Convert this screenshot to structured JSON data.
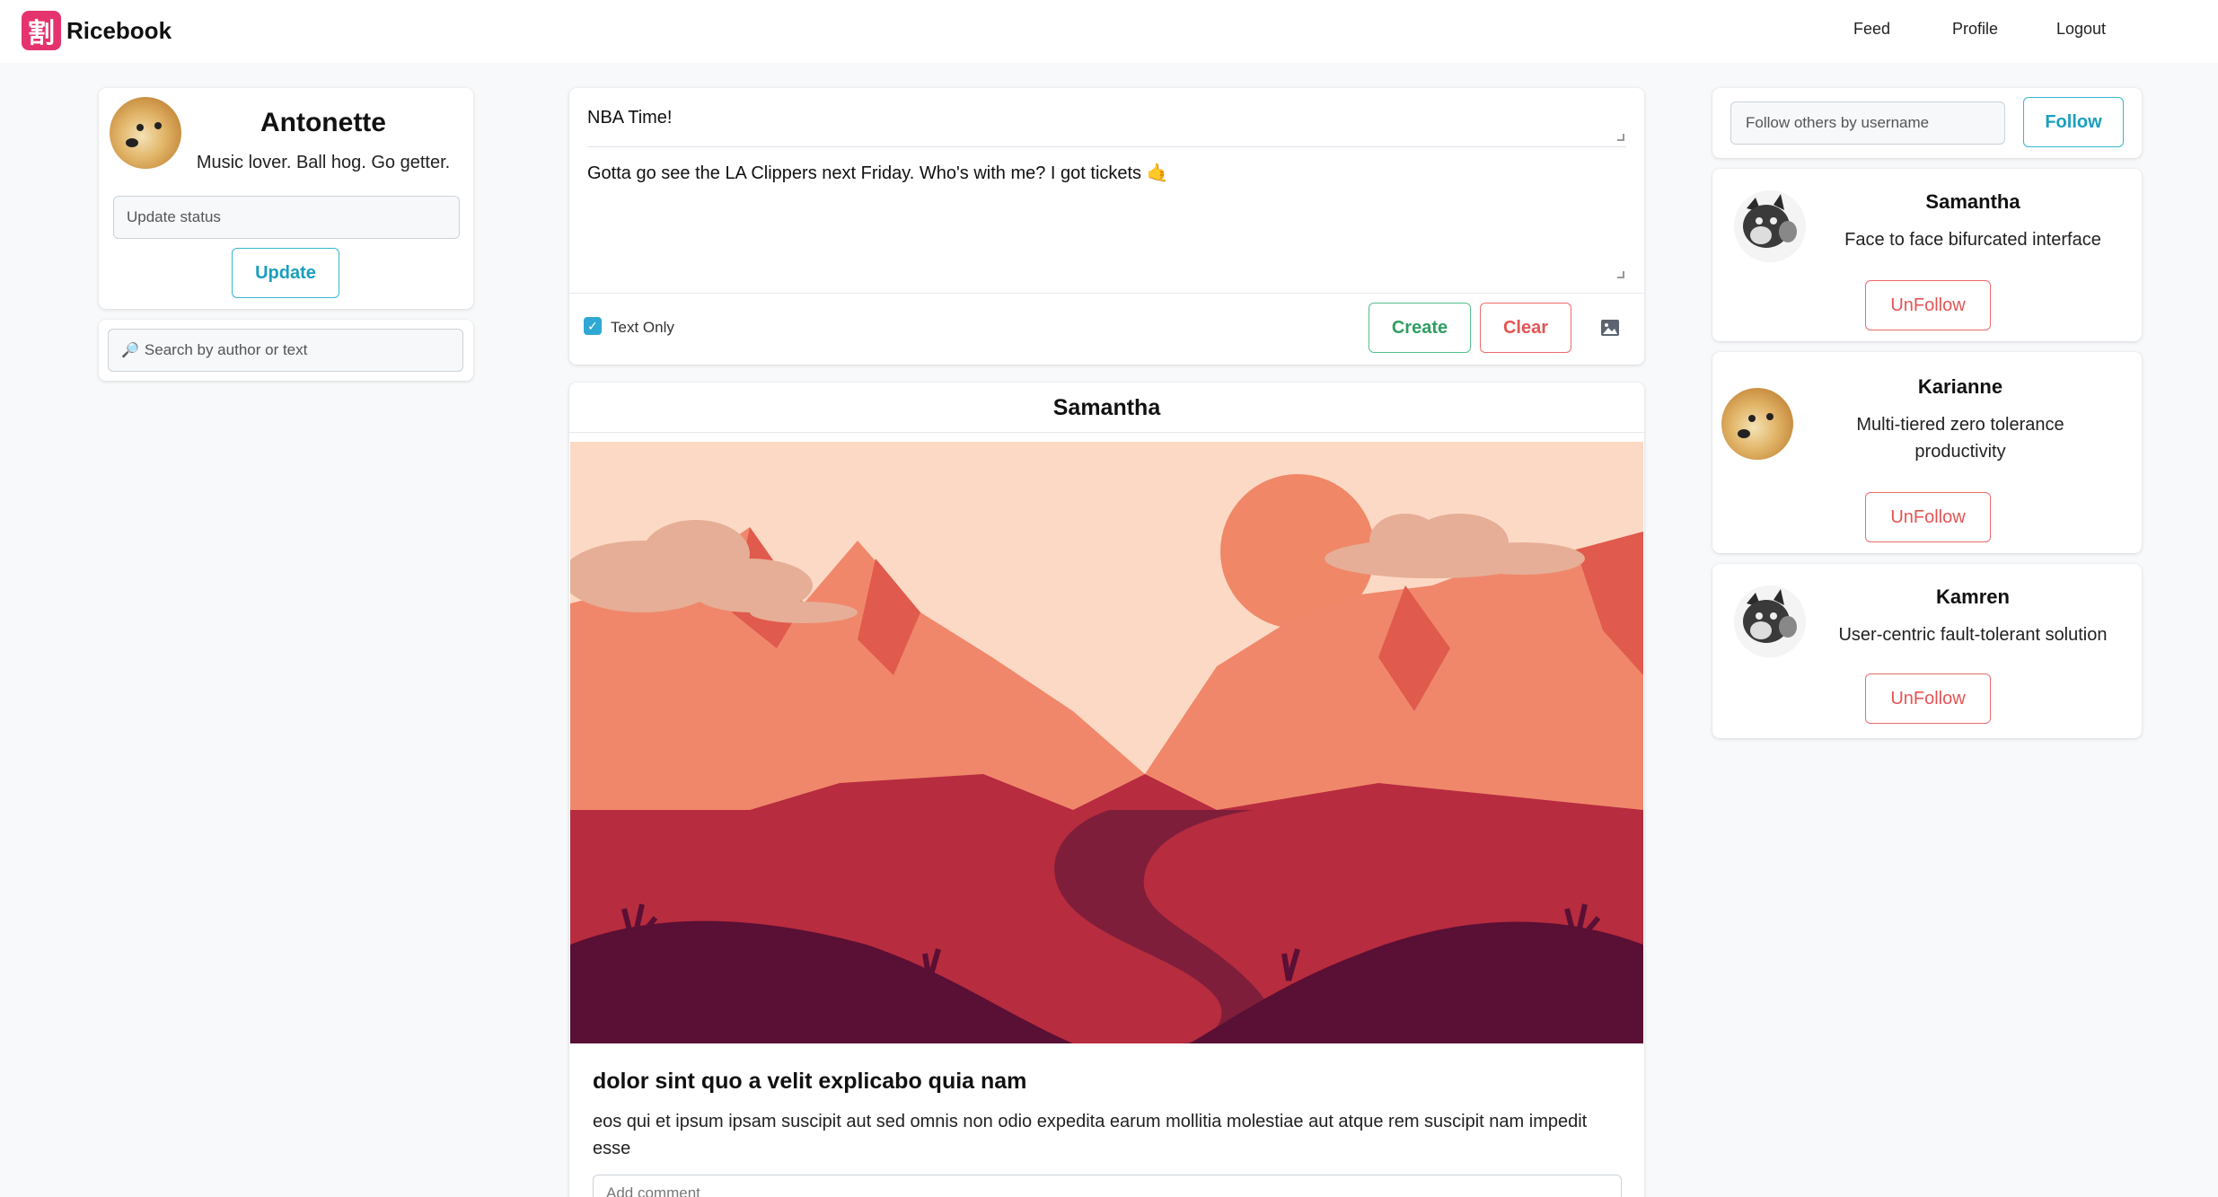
{
  "navbar": {
    "brand_logo": "割",
    "brand_name": "Ricebook",
    "links": {
      "feed": "Feed",
      "profile": "Profile",
      "logout": "Logout"
    }
  },
  "profile": {
    "name": "Antonette",
    "status": "Music lover. Ball hog. Go getter.",
    "status_placeholder": "Update status",
    "update_label": "Update"
  },
  "search": {
    "icon": "🔎",
    "placeholder": "Search by author or text"
  },
  "composer": {
    "title_value": "NBA Time!",
    "body_value": "Gotta go see the LA Clippers next Friday. Who's with me? I got tickets 🤙",
    "text_only_label": "Text Only",
    "text_only_checked": true,
    "create_label": "Create",
    "clear_label": "Clear",
    "image_icon": "image-icon"
  },
  "post": {
    "author": "Samantha",
    "title": "dolor sint quo a velit explicabo quia nam",
    "body": "eos qui et ipsum ipsam suscipit aut sed omnis non odio expedita earum mollitia molestiae aut atque rem suscipit nam impedit esse",
    "comment_placeholder": "Add comment"
  },
  "follow": {
    "placeholder": "Follow others by username",
    "follow_label": "Follow"
  },
  "following": [
    {
      "name": "Samantha",
      "status": "Face to face bifurcated interface",
      "avatar": "cat",
      "unfollow_label": "UnFollow"
    },
    {
      "name": "Karianne",
      "status": "Multi-tiered zero tolerance productivity",
      "avatar": "doge",
      "unfollow_label": "UnFollow"
    },
    {
      "name": "Kamren",
      "status": "User-centric fault-tolerant solution",
      "avatar": "cat",
      "unfollow_label": "UnFollow"
    }
  ],
  "colors": {
    "accent_cyan": "#1a9fbd",
    "accent_green": "#2f9e63",
    "accent_red": "#e55454",
    "brand": "#e5336e"
  }
}
